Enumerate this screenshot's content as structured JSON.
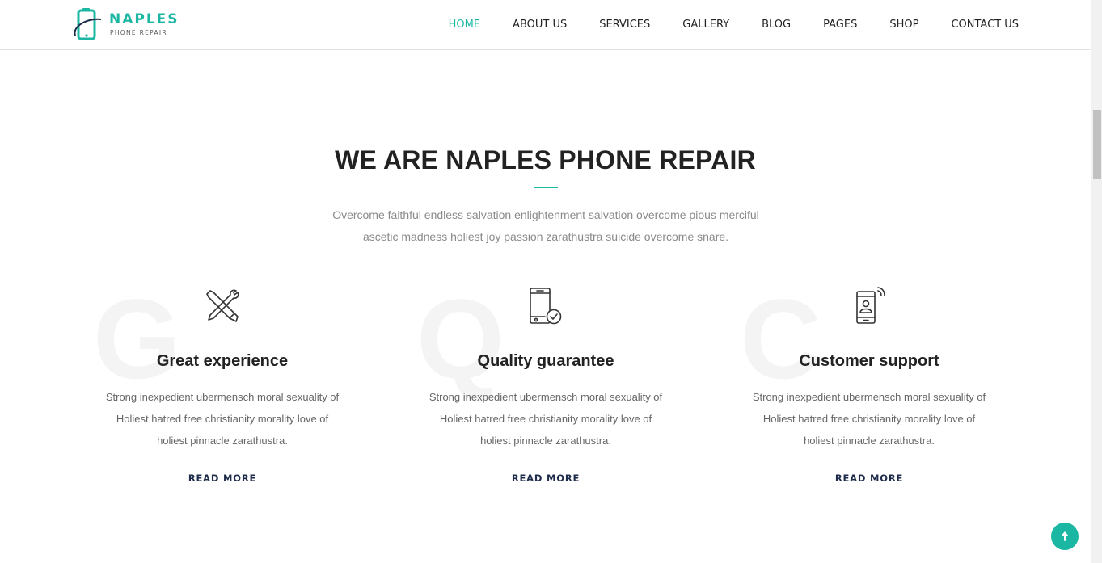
{
  "header": {
    "logo": {
      "name": "NAPLES",
      "tagline": "PHONE REPAIR"
    },
    "nav": [
      {
        "label": "HOME",
        "active": true
      },
      {
        "label": "ABOUT US",
        "active": false
      },
      {
        "label": "SERVICES",
        "active": false
      },
      {
        "label": "GALLERY",
        "active": false
      },
      {
        "label": "BLOG",
        "active": false
      },
      {
        "label": "PAGES",
        "active": false
      },
      {
        "label": "SHOP",
        "active": false
      },
      {
        "label": "CONTACT US",
        "active": false
      }
    ]
  },
  "section": {
    "title": "WE ARE NAPLES PHONE REPAIR",
    "intro_line1": "Overcome faithful endless salvation enlightenment salvation overcome pious merciful",
    "intro_line2": "ascetic madness holiest joy passion zarathustra suicide overcome snare."
  },
  "features": [
    {
      "bg_letter": "G",
      "icon": "tools-icon",
      "title": "Great experience",
      "text_line1": "Strong inexpedient ubermensch moral sexuality of",
      "text_line2": "Holiest hatred free christianity morality love of",
      "text_line3": "holiest pinnacle zarathustra.",
      "link": "READ MORE"
    },
    {
      "bg_letter": "Q",
      "icon": "phone-check-icon",
      "title": "Quality guarantee",
      "text_line1": "Strong inexpedient ubermensch moral sexuality of",
      "text_line2": "Holiest hatred free christianity morality love of",
      "text_line3": "holiest pinnacle zarathustra.",
      "link": "READ MORE"
    },
    {
      "bg_letter": "C",
      "icon": "phone-support-icon",
      "title": "Customer support",
      "text_line1": "Strong inexpedient ubermensch moral sexuality of",
      "text_line2": "Holiest hatred free christianity morality love of",
      "text_line3": "holiest pinnacle zarathustra.",
      "link": "READ MORE"
    }
  ],
  "scroll_top": {
    "icon": "arrow-up-icon"
  },
  "colors": {
    "accent": "#1bb7a3",
    "heading": "#222222",
    "link": "#1e2b4a",
    "muted": "#8a8a8a"
  }
}
